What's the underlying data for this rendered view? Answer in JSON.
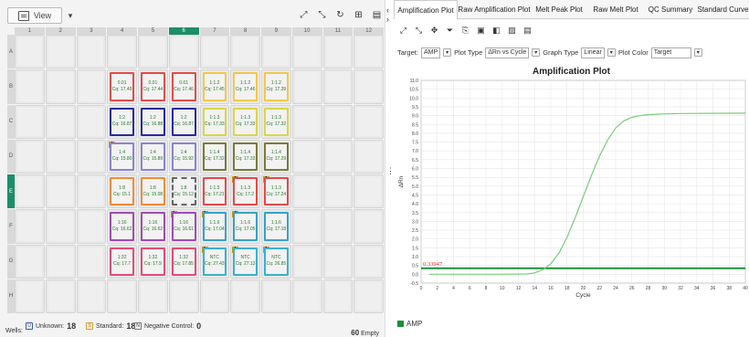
{
  "plate": {
    "view_label": "View",
    "columns": [
      "1",
      "2",
      "3",
      "4",
      "5",
      "6",
      "7",
      "8",
      "9",
      "10",
      "11",
      "12"
    ],
    "rows": [
      "A",
      "B",
      "C",
      "D",
      "E",
      "F",
      "G",
      "H"
    ],
    "selected_column": "6",
    "selected_row": "E",
    "wells": [
      {
        "row": "B",
        "col": 4,
        "q": "0.01",
        "cq": "Cq: 17.49",
        "color": "#e34a4a"
      },
      {
        "row": "B",
        "col": 5,
        "q": "0.01",
        "cq": "Cq: 17.44",
        "color": "#e34a4a"
      },
      {
        "row": "B",
        "col": 6,
        "q": "0.01",
        "cq": "Cq: 17.46",
        "color": "#e34a4a"
      },
      {
        "row": "B",
        "col": 7,
        "q": "1:1.2",
        "cq": "Cq: 17.45",
        "color": "#f1c94a"
      },
      {
        "row": "B",
        "col": 8,
        "q": "1:1.2",
        "cq": "Cq: 17.46",
        "color": "#f1c94a"
      },
      {
        "row": "B",
        "col": 9,
        "q": "1:1.2",
        "cq": "Cq: 17.39",
        "color": "#f1c94a"
      },
      {
        "row": "C",
        "col": 4,
        "q": "1:2",
        "cq": "Cq: 16.87",
        "color": "#2a2aa0"
      },
      {
        "row": "C",
        "col": 5,
        "q": "1:2",
        "cq": "Cq: 16.88",
        "color": "#2a2aa0"
      },
      {
        "row": "C",
        "col": 6,
        "q": "1:2",
        "cq": "Cq: 16.87",
        "color": "#2a2aa0"
      },
      {
        "row": "C",
        "col": 7,
        "q": "1:1.3",
        "cq": "Cq: 17.33",
        "color": "#d7d64a"
      },
      {
        "row": "C",
        "col": 8,
        "q": "1:1.3",
        "cq": "Cq: 17.33",
        "color": "#d7d64a"
      },
      {
        "row": "C",
        "col": 9,
        "q": "1:1.3",
        "cq": "Cq: 17.32",
        "color": "#d7d64a"
      },
      {
        "row": "D",
        "col": 4,
        "q": "1:4",
        "cq": "Cq: 15.80",
        "color": "#8a82d8",
        "flag": "1"
      },
      {
        "row": "D",
        "col": 5,
        "q": "1:4",
        "cq": "Cq: 15.89",
        "color": "#8a82d8"
      },
      {
        "row": "D",
        "col": 6,
        "q": "1:4",
        "cq": "Cq: 15.92",
        "color": "#8a82d8"
      },
      {
        "row": "D",
        "col": 7,
        "q": "1:1.4",
        "cq": "Cq: 17.32",
        "color": "#7a7a3a"
      },
      {
        "row": "D",
        "col": 8,
        "q": "1:1.4",
        "cq": "Cq: 17.33",
        "color": "#7a7a3a"
      },
      {
        "row": "D",
        "col": 9,
        "q": "1:1.4",
        "cq": "Cq: 17.29",
        "color": "#7a7a3a"
      },
      {
        "row": "E",
        "col": 4,
        "q": "1:8",
        "cq": "Cq: 15.1",
        "color": "#f08a3a"
      },
      {
        "row": "E",
        "col": 5,
        "q": "1:8",
        "cq": "Cq: 15.08",
        "color": "#f08a3a"
      },
      {
        "row": "E",
        "col": 6,
        "q": "1:8",
        "cq": "Cq: 15.12",
        "color": "#f08a3a",
        "dashed": true
      },
      {
        "row": "E",
        "col": 7,
        "q": "1:1.5",
        "cq": "Cq: 17.21",
        "color": "#e34a4a"
      },
      {
        "row": "E",
        "col": 8,
        "q": "1:1.3",
        "cq": "Cq: 17.2",
        "color": "#e34a4a",
        "flag": "1"
      },
      {
        "row": "E",
        "col": 9,
        "q": "1:1.3",
        "cq": "Cq: 17.24",
        "color": "#e34a4a",
        "flag": "1"
      },
      {
        "row": "F",
        "col": 4,
        "q": "1:16",
        "cq": "Cq: 16.62",
        "color": "#a04ab0"
      },
      {
        "row": "F",
        "col": 5,
        "q": "1:16",
        "cq": "Cq: 16.62",
        "color": "#a04ab0"
      },
      {
        "row": "F",
        "col": 6,
        "q": "1:16",
        "cq": "Cq: 16.61",
        "color": "#a04ab0",
        "flag": "1"
      },
      {
        "row": "F",
        "col": 7,
        "q": "1:1.6",
        "cq": "Cq: 17.04",
        "color": "#3aa0c8",
        "flag": "1"
      },
      {
        "row": "F",
        "col": 8,
        "q": "1:1.6",
        "cq": "Cq: 17.05",
        "color": "#3aa0c8",
        "flag": "1"
      },
      {
        "row": "F",
        "col": 9,
        "q": "1:1.6",
        "cq": "Cq: 17.18",
        "color": "#3aa0c8"
      },
      {
        "row": "G",
        "col": 4,
        "q": "1:32",
        "cq": "Cq: 17.7",
        "color": "#e34a7a"
      },
      {
        "row": "G",
        "col": 5,
        "q": "1:32",
        "cq": "Cq: 17.9",
        "color": "#e34a7a"
      },
      {
        "row": "G",
        "col": 6,
        "q": "1:32",
        "cq": "Cq: 17.85",
        "color": "#e34a7a"
      },
      {
        "row": "G",
        "col": 7,
        "q": "NTC",
        "cq": "Cq: 27.43",
        "color": "#3ab0d0",
        "flag": "1"
      },
      {
        "row": "G",
        "col": 8,
        "q": "NTC",
        "cq": "Cq: 27.13",
        "color": "#3ab0d0",
        "flag": "1"
      },
      {
        "row": "G",
        "col": 9,
        "q": "NTC",
        "cq": "Cq: 26.85",
        "color": "#3ab0d0",
        "flag": "1"
      }
    ]
  },
  "footer": {
    "wells_label": "Wells:",
    "unknown_icon": "U",
    "unknown_label": "Unknown:",
    "unknown_count": "18",
    "standard_icon": "S",
    "standard_label": "Standard:",
    "standard_count": "18",
    "neg_icon": "N",
    "neg_label": "Negative Control:",
    "neg_count": "0",
    "empty_count": "60",
    "empty_label": "Empty"
  },
  "tabs": [
    "Amplification Plot",
    "Raw Amplification Plot",
    "Melt Peak Plot",
    "Raw Melt Plot",
    "QC Summary",
    "Standard Curve"
  ],
  "options": {
    "target_label": "Target:",
    "target_value": "AMP",
    "plot_type_label": "Plot Type",
    "plot_type_value": "ΔRn vs Cycle",
    "graph_type_label": "Graph Type",
    "graph_type_value": "Linear",
    "plot_color_label": "Plot Color",
    "plot_color_value": "Target"
  },
  "colors": {
    "accent": "#1d8e6a",
    "curve": "#7acb7a",
    "threshold": "#1d8e3a",
    "threshold_label": "#d43030"
  },
  "chart_data": {
    "type": "line",
    "title": "Amplification Plot",
    "xlabel": "Cycle",
    "ylabel": "ΔRn",
    "xlim": [
      0,
      40
    ],
    "ylim": [
      -0.5,
      11.0
    ],
    "x_ticks": [
      0,
      2,
      4,
      6,
      8,
      10,
      12,
      14,
      16,
      18,
      20,
      22,
      24,
      26,
      28,
      30,
      32,
      34,
      36,
      38,
      40
    ],
    "y_ticks": [
      -0.5,
      0.0,
      0.5,
      1.0,
      1.5,
      2.0,
      2.5,
      3.0,
      3.5,
      4.0,
      4.5,
      5.0,
      5.5,
      6.0,
      6.5,
      7.0,
      7.5,
      8.0,
      8.5,
      9.0,
      9.5,
      10.0,
      10.5,
      11.0
    ],
    "threshold": 0.33947,
    "threshold_label": "0.33947",
    "series": [
      {
        "name": "AMP",
        "x": [
          1,
          5,
          10,
          13,
          14,
          15,
          16,
          17,
          18,
          19,
          20,
          21,
          22,
          23,
          24,
          25,
          26,
          27,
          28,
          30,
          32,
          35,
          40
        ],
        "y": [
          0.0,
          0.0,
          0.0,
          0.02,
          0.08,
          0.25,
          0.6,
          1.2,
          2.1,
          3.2,
          4.4,
          5.6,
          6.7,
          7.6,
          8.3,
          8.7,
          8.9,
          9.0,
          9.05,
          9.1,
          9.12,
          9.13,
          9.14
        ]
      }
    ],
    "legend": "bottom-left"
  }
}
